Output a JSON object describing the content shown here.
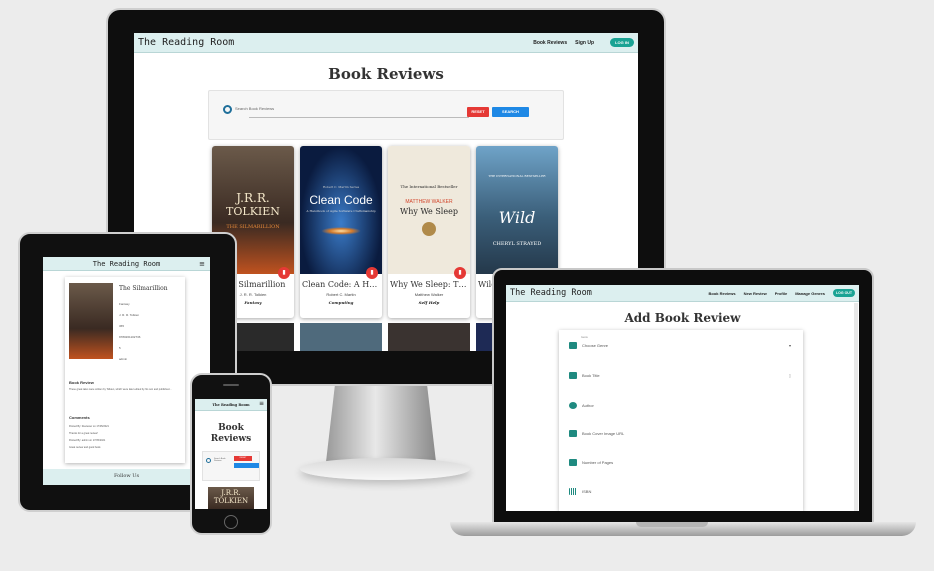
{
  "desktop": {
    "brand": "The Reading Room",
    "nav": [
      "Book Reviews",
      "Sign Up"
    ],
    "login": "LOG IN",
    "heading": "Book Reviews",
    "search_placeholder": "Search Book Reviews",
    "reset": "RESET",
    "search": "SEARCH",
    "books": [
      {
        "title": "The Silmarillion",
        "author": "J. R. R. Tolkien",
        "genre": "Fantasy",
        "cover_top": "J.R.R.",
        "cover_mid": "TOLKIEN",
        "cover_bot": "THE SILMARILLION"
      },
      {
        "title": "Clean Code: A Handbook",
        "author": "Robert C. Martin",
        "genre": "Computing",
        "cover_top": "Robert C. Martin Series",
        "cover_mid": "Clean Code",
        "cover_bot": "A Handbook of Agile Software Craftsmanship"
      },
      {
        "title": "Why We Sleep: The New Science",
        "author": "Matthew Walker",
        "genre": "Self Help",
        "cover_top": "The International Bestseller",
        "cover_mid": "MATTHEW WALKER",
        "cover_bot": "Why We Sleep"
      },
      {
        "title": "Wild",
        "author": "Cheryl Strayed",
        "genre": "",
        "cover_top": "THE INTERNATIONAL BESTSELLER",
        "cover_mid": "Wild",
        "cover_bot": "CHERYL STRAYED"
      }
    ]
  },
  "tablet": {
    "brand": "The Reading Room",
    "book_title": "The Silmarillion",
    "details": [
      "Fantasy",
      "J. R. R. Tolkien",
      "365",
      "9780261102736",
      "5",
      "admin"
    ],
    "section": "Book Review",
    "review": "These great tales were written by Tolkien, which were later edited by his son and published...",
    "comments_heading": "Comments",
    "comments": [
      "Posted By: Reviewer on 17/05/2021",
      "Thanks for a great review!",
      "Posted By: admin on 17/05/2021",
      "Great review and good book."
    ],
    "footer": "Follow Us"
  },
  "phone": {
    "brand": "The Reading Room",
    "heading": "Book Reviews",
    "search_placeholder": "Search Book Reviews",
    "reset": "RESET",
    "cover_top": "J.R.R.",
    "cover_mid": "TOLKIEN"
  },
  "laptop": {
    "brand": "The Reading Room",
    "nav": [
      "Book Reviews",
      "New Review",
      "Profile",
      "Manage Genres"
    ],
    "logout": "LOG OUT",
    "heading": "Add Book Review",
    "genre_label": "Genre",
    "genre_value": "Choose Genre",
    "fields": [
      "Book Title",
      "Author",
      "Book Cover Image URL",
      "Number of Pages",
      "ISBN"
    ]
  },
  "colors": {
    "teal": "#1aa394",
    "navbar": "#dcefef",
    "reset": "#e53935",
    "search": "#1e88e5"
  }
}
